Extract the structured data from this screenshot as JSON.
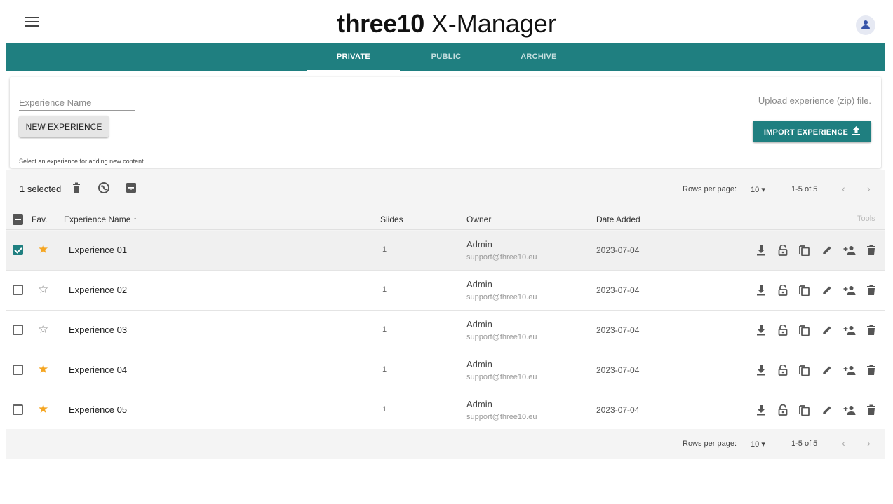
{
  "header": {
    "brand_bold": "three10",
    "brand_light": " X-Manager"
  },
  "tabs": [
    {
      "label": "PRIVATE",
      "active": true
    },
    {
      "label": "PUBLIC",
      "active": false
    },
    {
      "label": "ARCHIVE",
      "active": false
    }
  ],
  "create": {
    "name_placeholder": "Experience Name",
    "new_button": "NEW EXPERIENCE",
    "hint": "Select an experience for adding new content",
    "upload_text": "Upload experience (zip) file.",
    "import_button": "IMPORT EXPERIENCE"
  },
  "toolbar": {
    "selected_text": "1 selected"
  },
  "pagination": {
    "rows_label": "Rows per page:",
    "rows_value": "10",
    "range": "1-5 of 5"
  },
  "columns": {
    "fav": "Fav.",
    "name": "Experience Name",
    "slides": "Slides",
    "owner": "Owner",
    "date": "Date Added",
    "tools": "Tools"
  },
  "rows": [
    {
      "name": "Experience 01",
      "slides": "1",
      "owner": "Admin",
      "email": "support@three10.eu",
      "date": "2023-07-04",
      "selected": true,
      "favorite": true
    },
    {
      "name": "Experience 02",
      "slides": "1",
      "owner": "Admin",
      "email": "support@three10.eu",
      "date": "2023-07-04",
      "selected": false,
      "favorite": false
    },
    {
      "name": "Experience 03",
      "slides": "1",
      "owner": "Admin",
      "email": "support@three10.eu",
      "date": "2023-07-04",
      "selected": false,
      "favorite": false
    },
    {
      "name": "Experience 04",
      "slides": "1",
      "owner": "Admin",
      "email": "support@three10.eu",
      "date": "2023-07-04",
      "selected": false,
      "favorite": true
    },
    {
      "name": "Experience 05",
      "slides": "1",
      "owner": "Admin",
      "email": "support@three10.eu",
      "date": "2023-07-04",
      "selected": false,
      "favorite": true
    }
  ],
  "colors": {
    "accent": "#1f7f80",
    "star_on": "#f5a623",
    "star_off": "#777777"
  },
  "icons": {
    "row_tools": [
      "download-icon",
      "lock-open-icon",
      "copy-icon",
      "edit-icon",
      "add-user-icon",
      "delete-icon"
    ],
    "toolbar": [
      "delete-icon",
      "globe-icon",
      "archive-icon"
    ]
  }
}
